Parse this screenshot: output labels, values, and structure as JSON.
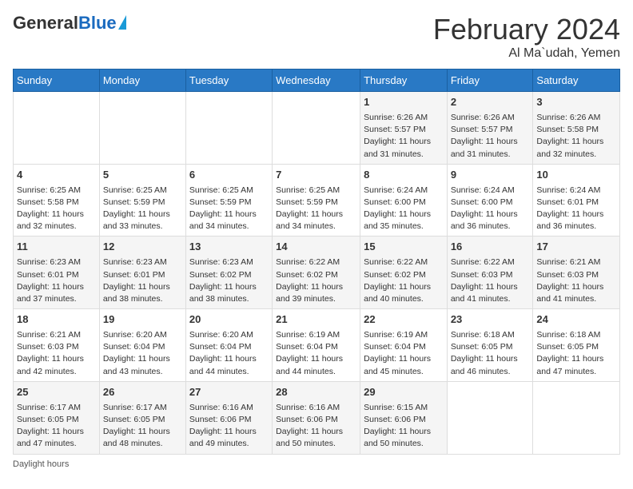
{
  "header": {
    "logo_general": "General",
    "logo_blue": "Blue",
    "month_title": "February 2024",
    "location": "Al Ma`udah, Yemen"
  },
  "weekdays": [
    "Sunday",
    "Monday",
    "Tuesday",
    "Wednesday",
    "Thursday",
    "Friday",
    "Saturday"
  ],
  "weeks": [
    [
      {
        "day": "",
        "empty": true
      },
      {
        "day": "",
        "empty": true
      },
      {
        "day": "",
        "empty": true
      },
      {
        "day": "",
        "empty": true
      },
      {
        "day": "1",
        "sunrise": "Sunrise: 6:26 AM",
        "sunset": "Sunset: 5:57 PM",
        "daylight": "Daylight: 11 hours and 31 minutes."
      },
      {
        "day": "2",
        "sunrise": "Sunrise: 6:26 AM",
        "sunset": "Sunset: 5:57 PM",
        "daylight": "Daylight: 11 hours and 31 minutes."
      },
      {
        "day": "3",
        "sunrise": "Sunrise: 6:26 AM",
        "sunset": "Sunset: 5:58 PM",
        "daylight": "Daylight: 11 hours and 32 minutes."
      }
    ],
    [
      {
        "day": "4",
        "sunrise": "Sunrise: 6:25 AM",
        "sunset": "Sunset: 5:58 PM",
        "daylight": "Daylight: 11 hours and 32 minutes."
      },
      {
        "day": "5",
        "sunrise": "Sunrise: 6:25 AM",
        "sunset": "Sunset: 5:59 PM",
        "daylight": "Daylight: 11 hours and 33 minutes."
      },
      {
        "day": "6",
        "sunrise": "Sunrise: 6:25 AM",
        "sunset": "Sunset: 5:59 PM",
        "daylight": "Daylight: 11 hours and 34 minutes."
      },
      {
        "day": "7",
        "sunrise": "Sunrise: 6:25 AM",
        "sunset": "Sunset: 5:59 PM",
        "daylight": "Daylight: 11 hours and 34 minutes."
      },
      {
        "day": "8",
        "sunrise": "Sunrise: 6:24 AM",
        "sunset": "Sunset: 6:00 PM",
        "daylight": "Daylight: 11 hours and 35 minutes."
      },
      {
        "day": "9",
        "sunrise": "Sunrise: 6:24 AM",
        "sunset": "Sunset: 6:00 PM",
        "daylight": "Daylight: 11 hours and 36 minutes."
      },
      {
        "day": "10",
        "sunrise": "Sunrise: 6:24 AM",
        "sunset": "Sunset: 6:01 PM",
        "daylight": "Daylight: 11 hours and 36 minutes."
      }
    ],
    [
      {
        "day": "11",
        "sunrise": "Sunrise: 6:23 AM",
        "sunset": "Sunset: 6:01 PM",
        "daylight": "Daylight: 11 hours and 37 minutes."
      },
      {
        "day": "12",
        "sunrise": "Sunrise: 6:23 AM",
        "sunset": "Sunset: 6:01 PM",
        "daylight": "Daylight: 11 hours and 38 minutes."
      },
      {
        "day": "13",
        "sunrise": "Sunrise: 6:23 AM",
        "sunset": "Sunset: 6:02 PM",
        "daylight": "Daylight: 11 hours and 38 minutes."
      },
      {
        "day": "14",
        "sunrise": "Sunrise: 6:22 AM",
        "sunset": "Sunset: 6:02 PM",
        "daylight": "Daylight: 11 hours and 39 minutes."
      },
      {
        "day": "15",
        "sunrise": "Sunrise: 6:22 AM",
        "sunset": "Sunset: 6:02 PM",
        "daylight": "Daylight: 11 hours and 40 minutes."
      },
      {
        "day": "16",
        "sunrise": "Sunrise: 6:22 AM",
        "sunset": "Sunset: 6:03 PM",
        "daylight": "Daylight: 11 hours and 41 minutes."
      },
      {
        "day": "17",
        "sunrise": "Sunrise: 6:21 AM",
        "sunset": "Sunset: 6:03 PM",
        "daylight": "Daylight: 11 hours and 41 minutes."
      }
    ],
    [
      {
        "day": "18",
        "sunrise": "Sunrise: 6:21 AM",
        "sunset": "Sunset: 6:03 PM",
        "daylight": "Daylight: 11 hours and 42 minutes."
      },
      {
        "day": "19",
        "sunrise": "Sunrise: 6:20 AM",
        "sunset": "Sunset: 6:04 PM",
        "daylight": "Daylight: 11 hours and 43 minutes."
      },
      {
        "day": "20",
        "sunrise": "Sunrise: 6:20 AM",
        "sunset": "Sunset: 6:04 PM",
        "daylight": "Daylight: 11 hours and 44 minutes."
      },
      {
        "day": "21",
        "sunrise": "Sunrise: 6:19 AM",
        "sunset": "Sunset: 6:04 PM",
        "daylight": "Daylight: 11 hours and 44 minutes."
      },
      {
        "day": "22",
        "sunrise": "Sunrise: 6:19 AM",
        "sunset": "Sunset: 6:04 PM",
        "daylight": "Daylight: 11 hours and 45 minutes."
      },
      {
        "day": "23",
        "sunrise": "Sunrise: 6:18 AM",
        "sunset": "Sunset: 6:05 PM",
        "daylight": "Daylight: 11 hours and 46 minutes."
      },
      {
        "day": "24",
        "sunrise": "Sunrise: 6:18 AM",
        "sunset": "Sunset: 6:05 PM",
        "daylight": "Daylight: 11 hours and 47 minutes."
      }
    ],
    [
      {
        "day": "25",
        "sunrise": "Sunrise: 6:17 AM",
        "sunset": "Sunset: 6:05 PM",
        "daylight": "Daylight: 11 hours and 47 minutes."
      },
      {
        "day": "26",
        "sunrise": "Sunrise: 6:17 AM",
        "sunset": "Sunset: 6:05 PM",
        "daylight": "Daylight: 11 hours and 48 minutes."
      },
      {
        "day": "27",
        "sunrise": "Sunrise: 6:16 AM",
        "sunset": "Sunset: 6:06 PM",
        "daylight": "Daylight: 11 hours and 49 minutes."
      },
      {
        "day": "28",
        "sunrise": "Sunrise: 6:16 AM",
        "sunset": "Sunset: 6:06 PM",
        "daylight": "Daylight: 11 hours and 50 minutes."
      },
      {
        "day": "29",
        "sunrise": "Sunrise: 6:15 AM",
        "sunset": "Sunset: 6:06 PM",
        "daylight": "Daylight: 11 hours and 50 minutes."
      },
      {
        "day": "",
        "empty": true
      },
      {
        "day": "",
        "empty": true
      }
    ]
  ],
  "footer": {
    "daylight_label": "Daylight hours"
  }
}
